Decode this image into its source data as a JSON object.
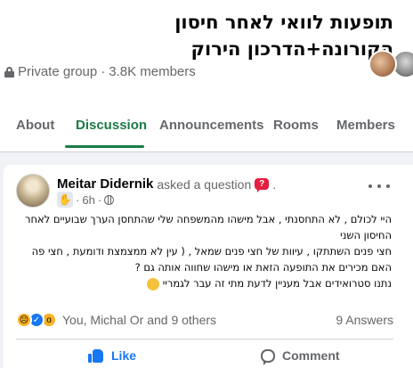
{
  "group": {
    "title": "תופעות לוואי לאחר חיסון הקורונה+הדרכון הירוק",
    "privacy": "Private group",
    "separator": "·",
    "members_count": "3.8K members"
  },
  "tabs": [
    {
      "label": "About",
      "active": false
    },
    {
      "label": "Discussion",
      "active": true
    },
    {
      "label": "Announcements",
      "active": false
    },
    {
      "label": "Rooms",
      "active": false
    },
    {
      "label": "Members",
      "active": false
    }
  ],
  "colors": {
    "accent": "#1b7a47",
    "link": "#1877f2",
    "question_badge": "#e41e3f"
  },
  "post": {
    "author": "Meitar Didernik",
    "action": "asked a question",
    "trailing": ".",
    "time": "6h",
    "dot": "·",
    "body_lines": [
      "היי לכולם , לא התחסנתי , אבל מישהו מהמשפחה שלי שהתחסן הערך שבועיים לאחר החיסון השני",
      "חצי פנים השתתקו , עיוות של חצי פנים שמאל , ( עין לא ממצמצת ודומעת , חצי פה",
      "האם מכירים את התופעה הזאת או מישהו שחווה אותה גם ?",
      "נתנו סטרואידים אבל מעניין לדעת מתי זה עבר לגמריי"
    ],
    "reaction_names": "You, Michal Or and 9 others",
    "answers": "9 Answers",
    "like_label": "Like",
    "comment_label": "Comment"
  }
}
